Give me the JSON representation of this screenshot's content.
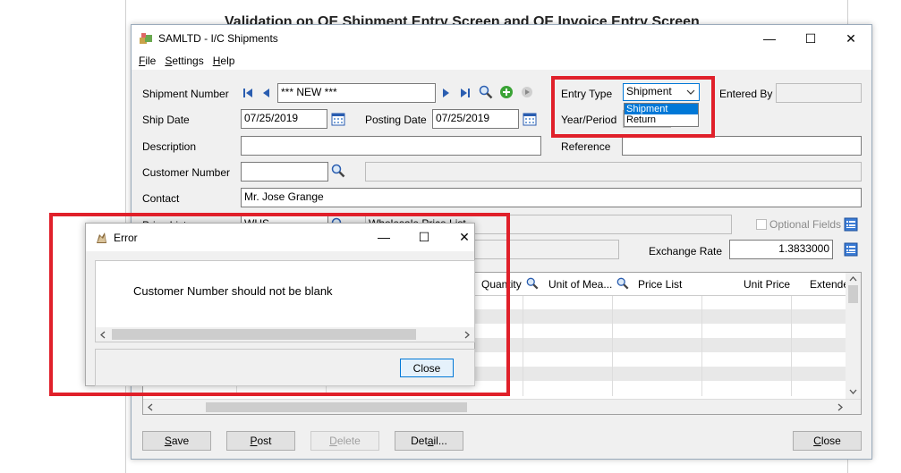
{
  "document": {
    "heading": "Validation on OE Shipment Entry Screen and OE Invoice Entry Screen"
  },
  "window": {
    "title": "SAMLTD - I/C Shipments",
    "minimize": "—",
    "maximize": "☐",
    "close": "✕"
  },
  "menu": {
    "file": "File",
    "settings": "Settings",
    "help": "Help"
  },
  "form": {
    "shipment_number_label": "Shipment Number",
    "shipment_number_value": "*** NEW ***",
    "ship_date_label": "Ship Date",
    "ship_date_value": "07/25/2019",
    "posting_date_label": "Posting Date",
    "posting_date_value": "07/25/2019",
    "description_label": "Description",
    "description_value": "",
    "customer_number_label": "Customer Number",
    "customer_number_value": "",
    "contact_label": "Contact",
    "contact_value": "Mr. Jose Grange",
    "price_list_label": "Price List",
    "price_list_code": "WHS",
    "price_list_desc": "Wholesale Price List",
    "entry_type_label": "Entry Type",
    "entry_type_value": "Shipment",
    "entry_type_options": [
      "Shipment",
      "Return"
    ],
    "year_period_label": "Year/Period",
    "entered_by_label": "Entered By",
    "entered_by_value": "",
    "reference_label": "Reference",
    "reference_value": "",
    "optional_fields_label": "Optional Fields",
    "exchange_rate_label": "Exchange Rate",
    "exchange_rate_value": "1.3833000"
  },
  "grid": {
    "columns": [
      "Quantity",
      "Unit of Mea...",
      "Price List",
      "Unit Price",
      "Extended"
    ]
  },
  "buttons": {
    "save": "Save",
    "save_u": "S",
    "save_rest": "ave",
    "post": "Post",
    "post_u": "P",
    "post_rest": "ost",
    "delete": "Delete",
    "delete_u": "D",
    "delete_rest": "elete",
    "detail": "Detail...",
    "detail_pre": "Det",
    "detail_u": "a",
    "detail_rest": "il...",
    "close": "Close",
    "close_u": "C",
    "close_rest": "lose"
  },
  "error_dialog": {
    "title": "Error",
    "message": "Customer Number should not be blank",
    "close_button": "Close"
  },
  "colors": {
    "highlight_red": "#e0202a",
    "selection_blue": "#0078d7"
  }
}
